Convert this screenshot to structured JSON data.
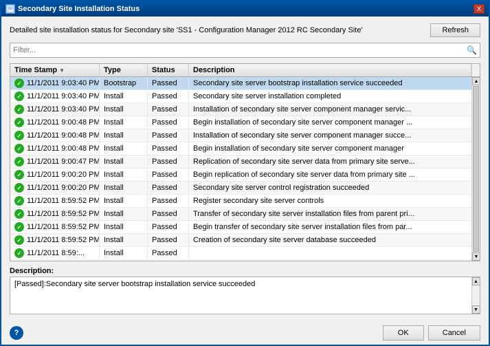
{
  "window": {
    "title": "Secondary Site Installation Status",
    "close_label": "X"
  },
  "subtitle": "Detailed site installation status for Secondary site 'SS1 - Configuration Manager 2012 RC Secondary Site'",
  "refresh_button": "Refresh",
  "filter_placeholder": "Filter...",
  "columns": [
    {
      "id": "timestamp",
      "label": "Time Stamp",
      "has_sort": true
    },
    {
      "id": "type",
      "label": "Type",
      "has_sort": false
    },
    {
      "id": "status",
      "label": "Status",
      "has_sort": false
    },
    {
      "id": "description",
      "label": "Description",
      "has_sort": false
    }
  ],
  "rows": [
    {
      "timestamp": "11/1/2011 9:03:40 PM",
      "type": "Bootstrap",
      "status": "Passed",
      "description": "Secondary site server bootstrap installation service succeeded",
      "selected": true
    },
    {
      "timestamp": "11/1/2011 9:03:40 PM",
      "type": "Install",
      "status": "Passed",
      "description": "Secondary site server installation completed"
    },
    {
      "timestamp": "11/1/2011 9:03:40 PM",
      "type": "Install",
      "status": "Passed",
      "description": "Installation of secondary site server component manager servic..."
    },
    {
      "timestamp": "11/1/2011 9:00:48 PM",
      "type": "Install",
      "status": "Passed",
      "description": "Begin installation of secondary site server component manager ..."
    },
    {
      "timestamp": "11/1/2011 9:00:48 PM",
      "type": "Install",
      "status": "Passed",
      "description": "Installation of secondary site server component manager succe..."
    },
    {
      "timestamp": "11/1/2011 9:00:48 PM",
      "type": "Install",
      "status": "Passed",
      "description": "Begin installation of secondary site server component manager"
    },
    {
      "timestamp": "11/1/2011 9:00:47 PM",
      "type": "Install",
      "status": "Passed",
      "description": "Replication of secondary site server data from primary site serve..."
    },
    {
      "timestamp": "11/1/2011 9:00:20 PM",
      "type": "Install",
      "status": "Passed",
      "description": "Begin replication of secondary site server data from primary site ..."
    },
    {
      "timestamp": "11/1/2011 9:00:20 PM",
      "type": "Install",
      "status": "Passed",
      "description": "Secondary site server control registration succeeded"
    },
    {
      "timestamp": "11/1/2011 8:59:52 PM",
      "type": "Install",
      "status": "Passed",
      "description": "Register secondary site server controls"
    },
    {
      "timestamp": "11/1/2011 8:59:52 PM",
      "type": "Install",
      "status": "Passed",
      "description": "Transfer of secondary site server installation files from parent pri..."
    },
    {
      "timestamp": "11/1/2011 8:59:52 PM",
      "type": "Install",
      "status": "Passed",
      "description": "Begin transfer of secondary site server installation files from par..."
    },
    {
      "timestamp": "11/1/2011 8:59:52 PM",
      "type": "Install",
      "status": "Passed",
      "description": "Creation of secondary site server database succeeded"
    },
    {
      "timestamp": "11/1/2011 8:59:...",
      "type": "Install",
      "status": "Passed",
      "description": ""
    }
  ],
  "description_section": {
    "label": "Description:",
    "value": "[Passed]:Secondary site server bootstrap installation service succeeded"
  },
  "footer": {
    "help_label": "?",
    "ok_label": "OK",
    "cancel_label": "Cancel"
  }
}
